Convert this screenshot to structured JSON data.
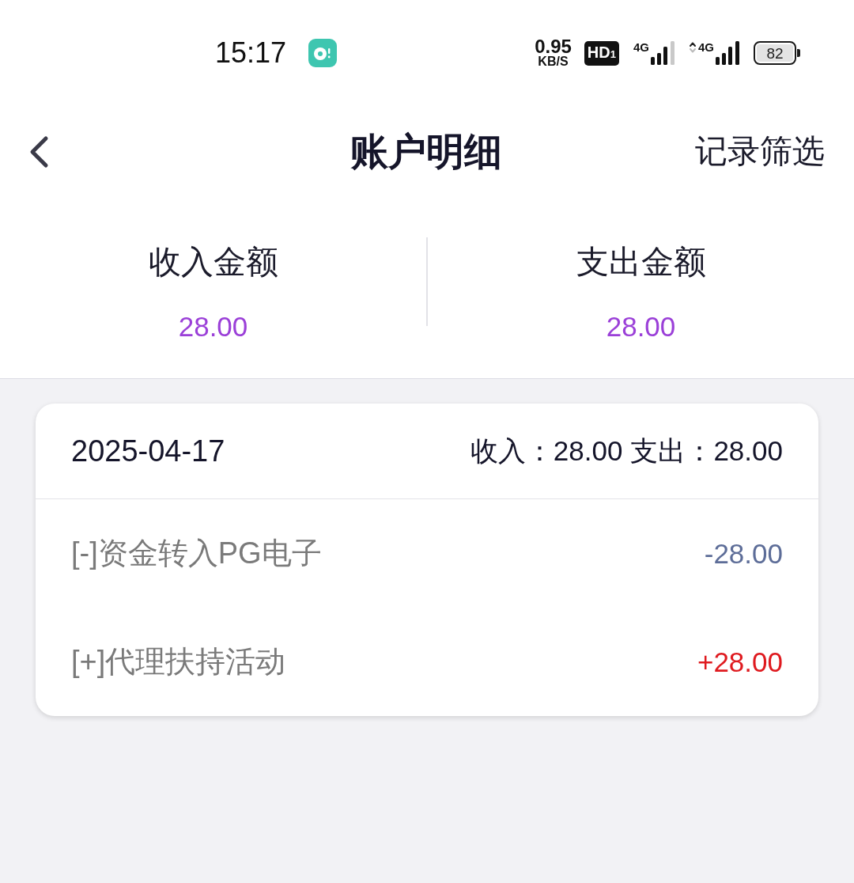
{
  "status_bar": {
    "time": "15:17",
    "network_speed": {
      "value": "0.95",
      "unit": "KB/S"
    },
    "hd_badge": "HD$_{1}$",
    "signals": [
      {
        "label": "4G",
        "kind": "idle"
      },
      {
        "label": "4G",
        "kind": "active"
      }
    ],
    "battery": "82"
  },
  "header": {
    "title": "账户明细",
    "action": "记录筛选"
  },
  "summary": [
    {
      "label": "收入金额",
      "value": "28.00"
    },
    {
      "label": "支出金额",
      "value": "28.00"
    }
  ],
  "day_groups": [
    {
      "date": "2025-04-17",
      "totals": [
        "收入：28.00",
        "支出：28.00"
      ],
      "records": [
        {
          "title": "[-]资金转入PG电子",
          "amount": "-28.00",
          "color": "#5d6d98"
        },
        {
          "title": "[+]代理扶持活动",
          "amount": "+28.00",
          "color": "#df1a1f"
        }
      ]
    }
  ]
}
